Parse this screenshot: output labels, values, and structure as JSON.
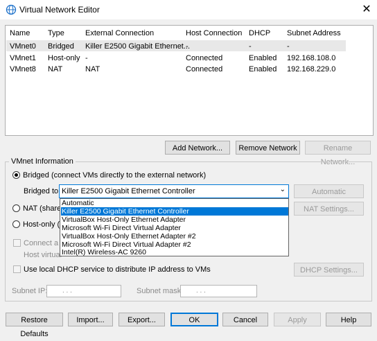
{
  "window": {
    "title": "Virtual Network Editor",
    "close_glyph": "✕"
  },
  "table": {
    "headers": [
      "Name",
      "Type",
      "External Connection",
      "Host Connection",
      "DHCP",
      "Subnet Address"
    ],
    "rows": [
      [
        "VMnet0",
        "Bridged",
        "Killer E2500 Gigabit Ethernet...",
        "-",
        "-",
        "-"
      ],
      [
        "VMnet1",
        "Host-only",
        "-",
        "Connected",
        "Enabled",
        "192.168.108.0"
      ],
      [
        "VMnet8",
        "NAT",
        "NAT",
        "Connected",
        "Enabled",
        "192.168.229.0"
      ]
    ]
  },
  "network_buttons": {
    "add": "Add Network...",
    "remove": "Remove Network",
    "rename": "Rename Network..."
  },
  "vmnet_info": {
    "group_label": "VMnet Information",
    "bridged_label": "Bridged (connect VMs directly to the external network)",
    "bridged_to_label": "Bridged to:",
    "bridged_to_value": "Killer E2500 Gigabit Ethernet Controller",
    "automatic_settings": "Automatic Settings...",
    "nat_label": "NAT (shared",
    "nat_settings": "NAT Settings...",
    "hostonly_label": "Host-only (c",
    "connect_host_label": "Connect a h",
    "host_virtual_label": "Host virtual",
    "dhcp_label": "Use local DHCP service to distribute IP address to VMs",
    "dhcp_settings": "DHCP Settings...",
    "subnet_ip_label": "Subnet IP:",
    "subnet_ip_value": ".     .     .",
    "subnet_mask_label": "Subnet mask:",
    "subnet_mask_value": ".     .     ."
  },
  "dropdown_options": [
    "Automatic",
    "Killer E2500 Gigabit Ethernet Controller",
    "VirtualBox Host-Only Ethernet Adapter",
    "Microsoft Wi-Fi Direct Virtual Adapter",
    "VirtualBox Host-Only Ethernet Adapter #2",
    "Microsoft Wi-Fi Direct Virtual Adapter #2",
    "Intel(R) Wireless-AC 9260"
  ],
  "footer_buttons": {
    "restore": "Restore Defaults",
    "import": "Import...",
    "export": "Export...",
    "ok": "OK",
    "cancel": "Cancel",
    "apply": "Apply",
    "help": "Help"
  },
  "colors": {
    "accent": "#0078d7",
    "disabled_text": "#9a9a9a"
  }
}
